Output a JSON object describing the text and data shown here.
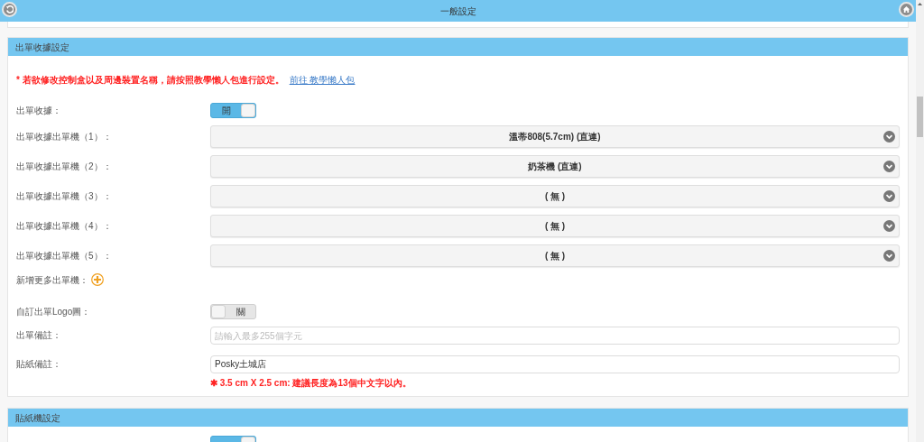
{
  "header": {
    "title": "一般設定"
  },
  "sections": [
    {
      "title": "出單收據設定",
      "notice": "* 若欲修改控制盒以及周邊裝置名稱，請按照教學懶人包進行設定。",
      "notice_link": "前往 教學懶人包",
      "rows": [
        {
          "kind": "toggle",
          "label": "出單收據：",
          "on": true,
          "state_text": "開"
        },
        {
          "kind": "select",
          "label": "出單收據出單機（1）：",
          "value": "溫蒂808(5.7cm) (直連)"
        },
        {
          "kind": "select",
          "label": "出單收據出單機（2）：",
          "value": "奶茶機 (直連)"
        },
        {
          "kind": "select",
          "label": "出單收據出單機（3）：",
          "value": "( 無 )"
        },
        {
          "kind": "select",
          "label": "出單收據出單機（4）：",
          "value": "( 無 )"
        },
        {
          "kind": "select",
          "label": "出單收據出單機（5）：",
          "value": "( 無 )"
        },
        {
          "kind": "add",
          "label": "新增更多出單機："
        },
        {
          "kind": "toggle",
          "label": "自訂出單Logo圖：",
          "on": false,
          "state_text": "關"
        },
        {
          "kind": "text",
          "label": "出單備註：",
          "placeholder": "請輸入最多255個字元"
        },
        {
          "kind": "text",
          "label": "貼紙備註：",
          "value": "Posky土城店",
          "note": "✱ 3.5 cm X 2.5 cm: 建議長度為13個中文字以內。"
        }
      ]
    },
    {
      "title": "貼紙機設定",
      "rows": [
        {
          "kind": "toggle",
          "on": true
        }
      ]
    }
  ]
}
